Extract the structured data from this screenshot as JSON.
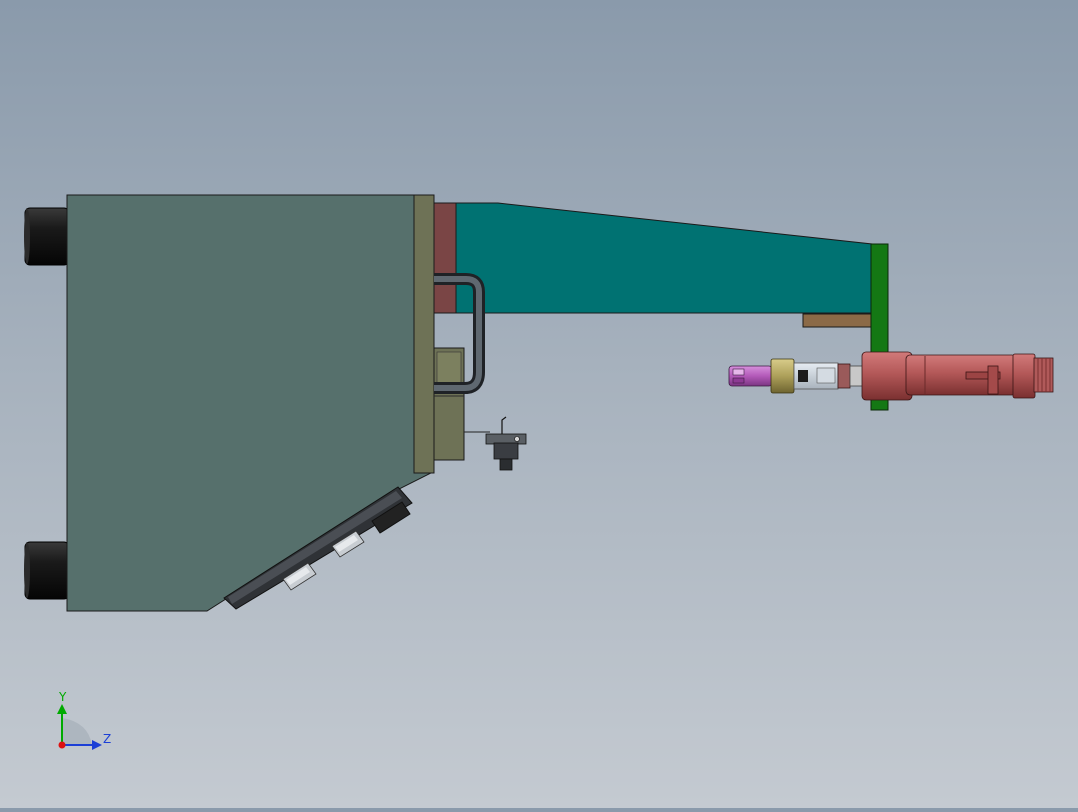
{
  "viewport": {
    "view_orientation": "side view",
    "background_colors": [
      "#8a9aab",
      "#c4cad1"
    ]
  },
  "model": {
    "parts": [
      {
        "name": "main-housing",
        "color": "#56706c"
      },
      {
        "name": "mounting-plate",
        "color": "#6e7256"
      },
      {
        "name": "spacer-block",
        "color": "#7a4545"
      },
      {
        "name": "boom-arm",
        "color": "#007272"
      },
      {
        "name": "end-flange-plate",
        "color": "#147814"
      },
      {
        "name": "support-bar",
        "color": "#8b6a47"
      },
      {
        "name": "torch-body",
        "color": "#b15757"
      },
      {
        "name": "gas-nozzle",
        "color": "#b15ab8"
      },
      {
        "name": "brass-collar",
        "color": "#b0a25a"
      },
      {
        "name": "cable-hose",
        "color": "#444a50"
      },
      {
        "name": "roller-wheels",
        "color": "#1c1c1c"
      },
      {
        "name": "control-panel",
        "color": "#3a3d42"
      }
    ]
  },
  "triad": {
    "y_label": "Y",
    "z_label": "Z",
    "y_color": "#00aa00",
    "z_color": "#1c3fd6",
    "x_color": "#dd1111"
  }
}
